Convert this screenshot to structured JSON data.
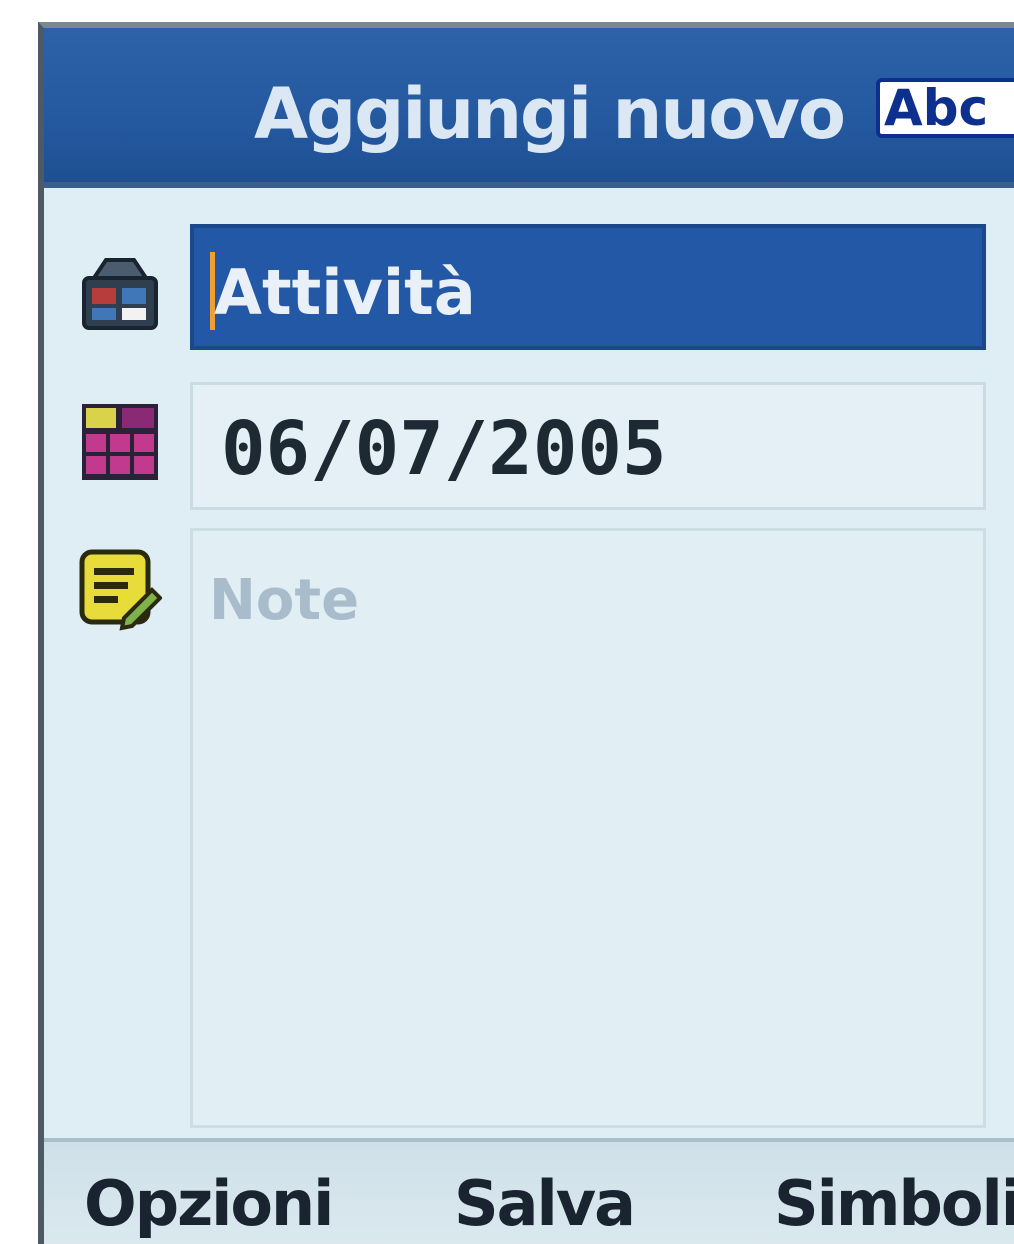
{
  "header": {
    "title": "Aggiungi nuovo",
    "input_mode": "Abc"
  },
  "form": {
    "task": {
      "icon": "briefcase-icon",
      "value": "Attività"
    },
    "date": {
      "icon": "calendar-icon",
      "value": "06/07/2005"
    },
    "note": {
      "icon": "note-icon",
      "placeholder": "Note"
    }
  },
  "softkeys": {
    "left": "Opzioni",
    "center": "Salva",
    "right": "Simboli"
  },
  "colors": {
    "titlebar": "#2459a0",
    "selected_field": "#2258a6",
    "background": "#dfeef4",
    "cursor": "#f0a030"
  }
}
